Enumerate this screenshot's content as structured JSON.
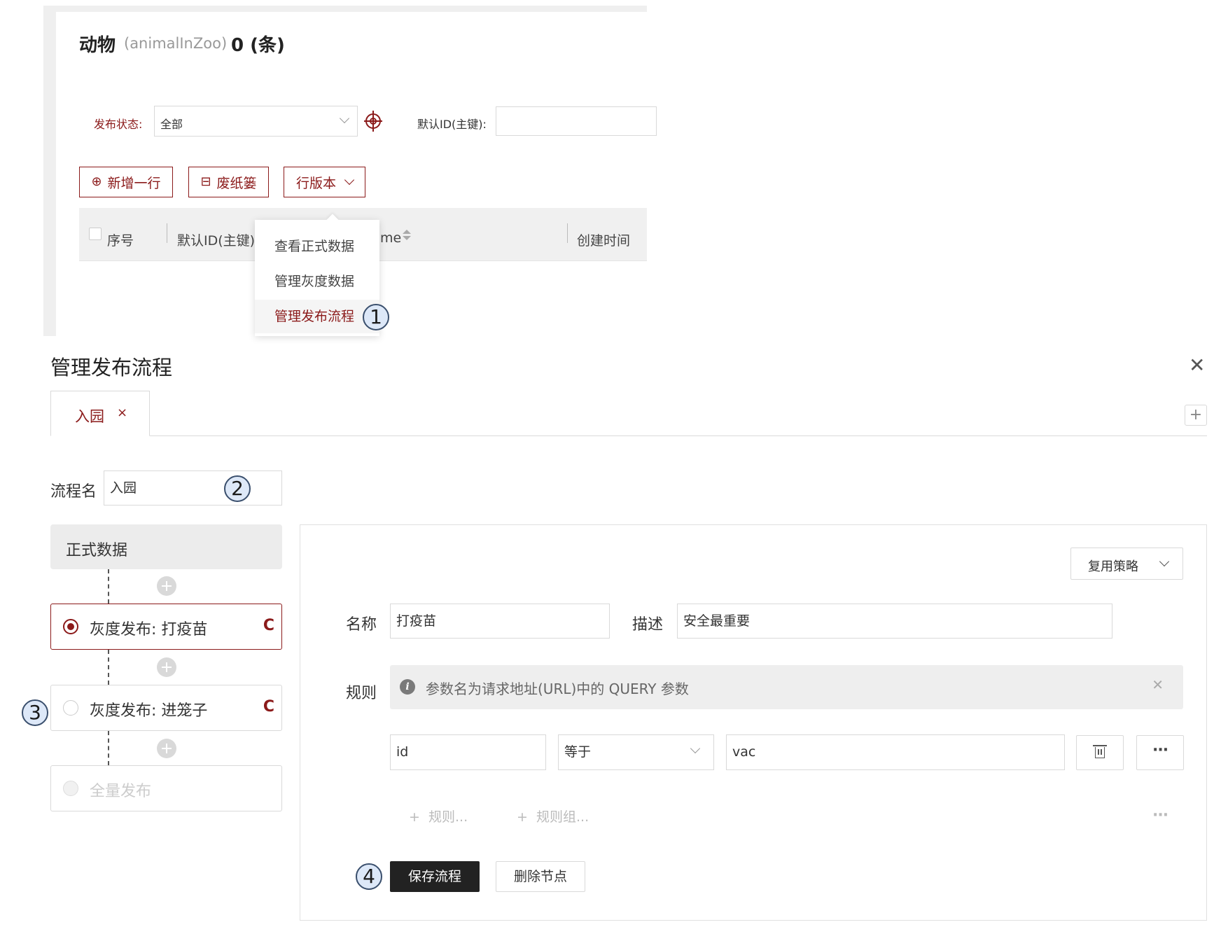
{
  "header": {
    "title": "动物",
    "model_name": "(animalInZoo)",
    "count": "0 (条)"
  },
  "filters": {
    "status_label": "发布状态:",
    "status_value": "全部",
    "id_label": "默认ID(主键):",
    "id_value": ""
  },
  "toolbar": {
    "add_row": "新增一行",
    "trash": "废纸篓",
    "row_version": "行版本"
  },
  "table": {
    "columns": [
      "序号",
      "默认ID(主键)",
      "me",
      "创建时间"
    ]
  },
  "version_menu": {
    "items": [
      "查看正式数据",
      "管理灰度数据",
      "管理发布流程"
    ],
    "active_index": 2
  },
  "callouts": [
    "1",
    "2",
    "3",
    "4"
  ],
  "drawer": {
    "title": "管理发布流程",
    "tabs": [
      {
        "label": "入园"
      }
    ],
    "flow_name_label": "流程名",
    "flow_name_value": "入园",
    "flow_nodes": {
      "formal": "正式数据",
      "nodes": [
        {
          "label": "灰度发布: 打疫苗",
          "badge": "C",
          "selected": true
        },
        {
          "label": "灰度发布: 进笼子",
          "badge": "C",
          "selected": false
        },
        {
          "label": "全量发布",
          "badge": "",
          "disabled": true
        }
      ]
    },
    "editor": {
      "reuse_strategy": "复用策略",
      "name_label": "名称",
      "name_value": "打疫苗",
      "desc_label": "描述",
      "desc_value": "安全最重要",
      "rules_label": "规则",
      "rules_hint": "参数名为请求地址(URL)中的 QUERY 参数",
      "rule": {
        "param": "id",
        "operator": "等于",
        "value": "vac"
      },
      "add_rule": "规则...",
      "add_rule_group": "规则组...",
      "save_button": "保存流程",
      "delete_button": "删除节点"
    }
  }
}
